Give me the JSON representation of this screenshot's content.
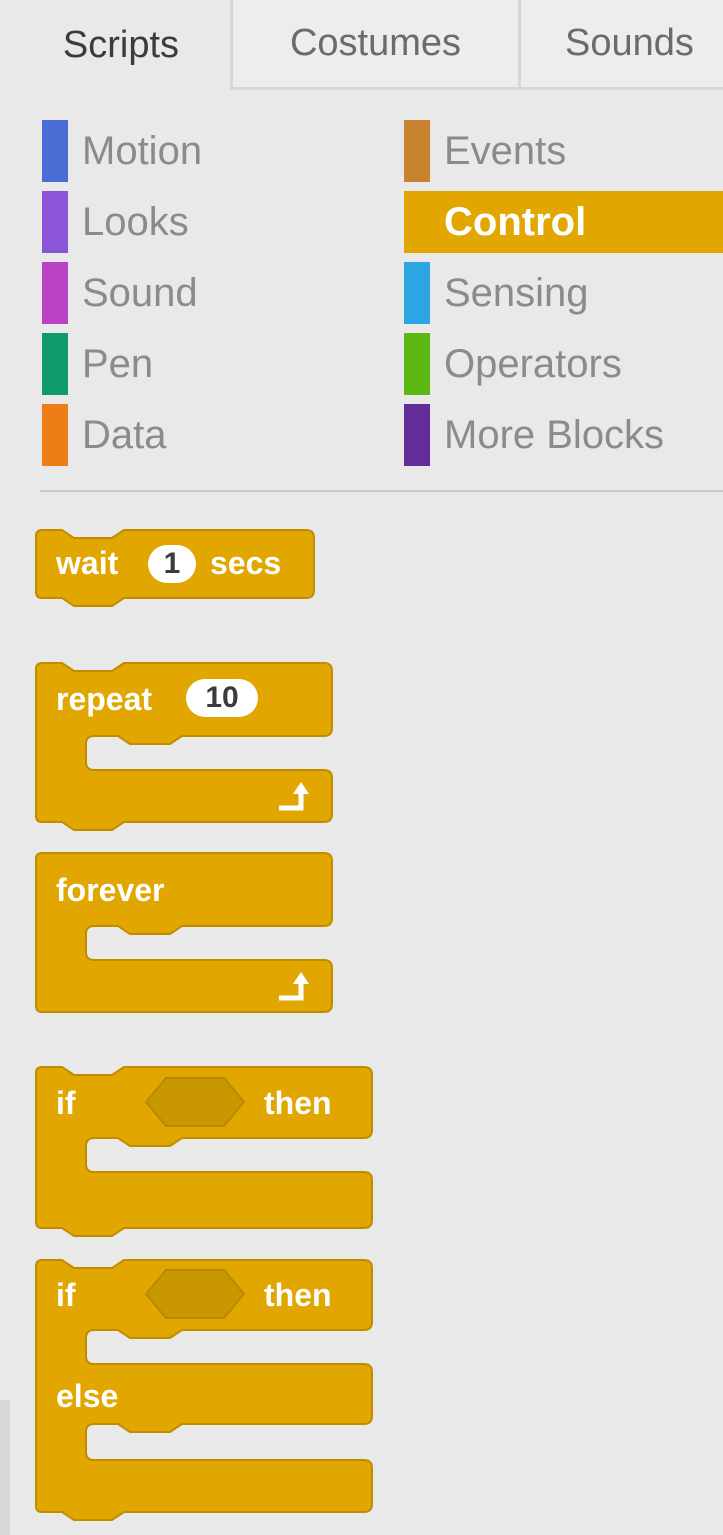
{
  "tabs": [
    "Scripts",
    "Costumes",
    "Sounds"
  ],
  "categories_left": [
    {
      "label": "Motion",
      "color": "#4a6cd4"
    },
    {
      "label": "Looks",
      "color": "#8a55d7"
    },
    {
      "label": "Sound",
      "color": "#bb42c3"
    },
    {
      "label": "Pen",
      "color": "#0e9a6c"
    },
    {
      "label": "Data",
      "color": "#ee7d16"
    }
  ],
  "categories_right": [
    {
      "label": "Events",
      "color": "#c88330"
    },
    {
      "label": "Control",
      "color": "#e1a91a"
    },
    {
      "label": "Sensing",
      "color": "#2ca5e2"
    },
    {
      "label": "Operators",
      "color": "#5cb712"
    },
    {
      "label": "More Blocks",
      "color": "#632d99"
    }
  ],
  "selected_category": "Control",
  "block_color": "#e1a700",
  "blocks": {
    "wait": {
      "label_before": "wait",
      "value": "1",
      "label_after": "secs"
    },
    "repeat": {
      "label": "repeat",
      "value": "10"
    },
    "forever": {
      "label": "forever"
    },
    "if_then": {
      "label_if": "if",
      "label_then": "then"
    },
    "if_else": {
      "label_if": "if",
      "label_then": "then",
      "label_else": "else"
    }
  }
}
